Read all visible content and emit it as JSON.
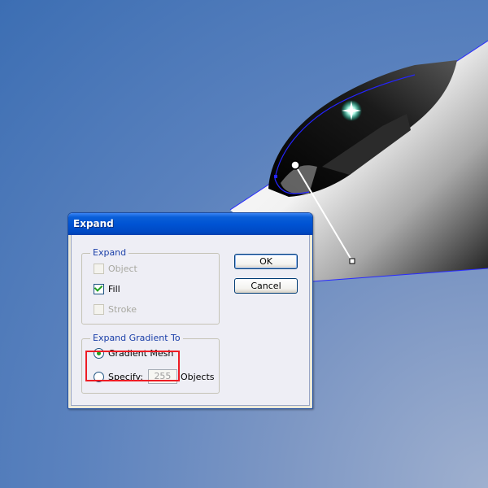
{
  "dialog": {
    "title": "Expand",
    "expand_group": {
      "legend": "Expand",
      "options": [
        {
          "label": "Object",
          "checked": false,
          "enabled": false
        },
        {
          "label": "Fill",
          "checked": true,
          "enabled": true
        },
        {
          "label": "Stroke",
          "checked": false,
          "enabled": false
        }
      ]
    },
    "gradient_group": {
      "legend": "Expand Gradient To",
      "gradient_mesh_label": "Gradient Mesh",
      "specify_label": "Specify:",
      "specify_value": "255",
      "objects_label": "Objects",
      "selected": "Gradient Mesh"
    },
    "ok_label": "OK",
    "cancel_label": "Cancel"
  },
  "colors": {
    "highlight": "#ee1c24",
    "titlebar": "#0053d3",
    "selection": "#2020ff"
  }
}
